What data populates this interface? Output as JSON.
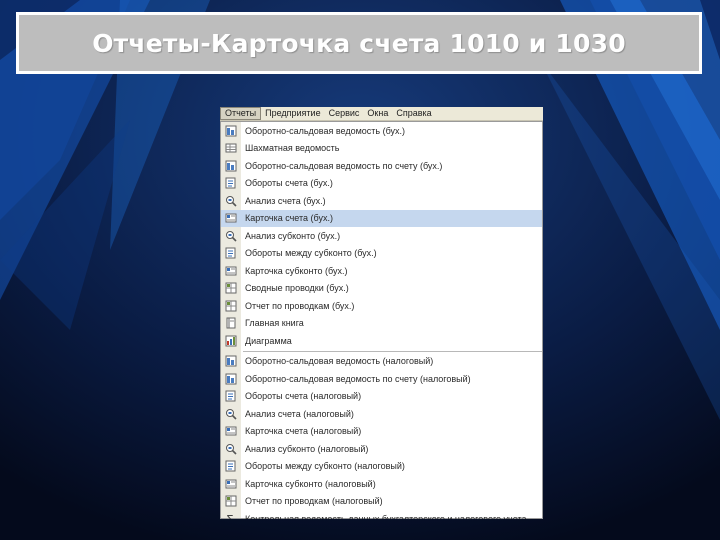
{
  "slide_title": "Отчеты-Карточка счета 1010 и 1030",
  "menubar": {
    "items": [
      "Отчеты",
      "Предприятие",
      "Сервис",
      "Окна",
      "Справка"
    ],
    "active_index": 0
  },
  "menu": {
    "group1": [
      {
        "label": "Оборотно-сальдовая ведомость (бух.)",
        "icon": "report-icon"
      },
      {
        "label": "Шахматная ведомость",
        "icon": "grid-icon"
      },
      {
        "label": "Оборотно-сальдовая ведомость по счету (бух.)",
        "icon": "report-icon"
      },
      {
        "label": "Обороты счета (бух.)",
        "icon": "turnover-icon"
      },
      {
        "label": "Анализ счета (бух.)",
        "icon": "analysis-icon"
      },
      {
        "label": "Карточка счета (бух.)",
        "icon": "card-icon",
        "selected": true
      },
      {
        "label": "Анализ субконто (бух.)",
        "icon": "analysis-icon"
      },
      {
        "label": "Обороты между субконто (бух.)",
        "icon": "turnover-icon"
      },
      {
        "label": "Карточка субконто (бух.)",
        "icon": "card-icon"
      },
      {
        "label": "Сводные проводки (бух.)",
        "icon": "entries-icon"
      },
      {
        "label": "Отчет по проводкам (бух.)",
        "icon": "entries-icon"
      },
      {
        "label": "Главная книга",
        "icon": "book-icon"
      },
      {
        "label": "Диаграмма",
        "icon": "diagram-icon"
      }
    ],
    "group2": [
      {
        "label": "Оборотно-сальдовая ведомость (налоговый)",
        "icon": "report-icon"
      },
      {
        "label": "Оборотно-сальдовая ведомость по счету (налоговый)",
        "icon": "report-icon"
      },
      {
        "label": "Обороты счета (налоговый)",
        "icon": "turnover-icon"
      },
      {
        "label": "Анализ счета (налоговый)",
        "icon": "analysis-icon"
      },
      {
        "label": "Карточка счета (налоговый)",
        "icon": "card-icon"
      },
      {
        "label": "Анализ субконто (налоговый)",
        "icon": "analysis-icon"
      },
      {
        "label": "Обороты между субконто (налоговый)",
        "icon": "turnover-icon"
      },
      {
        "label": "Карточка субконто (налоговый)",
        "icon": "card-icon"
      },
      {
        "label": "Отчет по проводкам (налоговый)",
        "icon": "entries-icon"
      },
      {
        "label": "Контрольная ведомость данных бухгалтерского и налогового учета",
        "icon": "sigma-icon"
      }
    ]
  },
  "colors": {
    "background": "#071430",
    "accent_blue": "#1f6fd6",
    "title_box": "#bdbdbd",
    "selected_row": "#c5d7ee"
  }
}
